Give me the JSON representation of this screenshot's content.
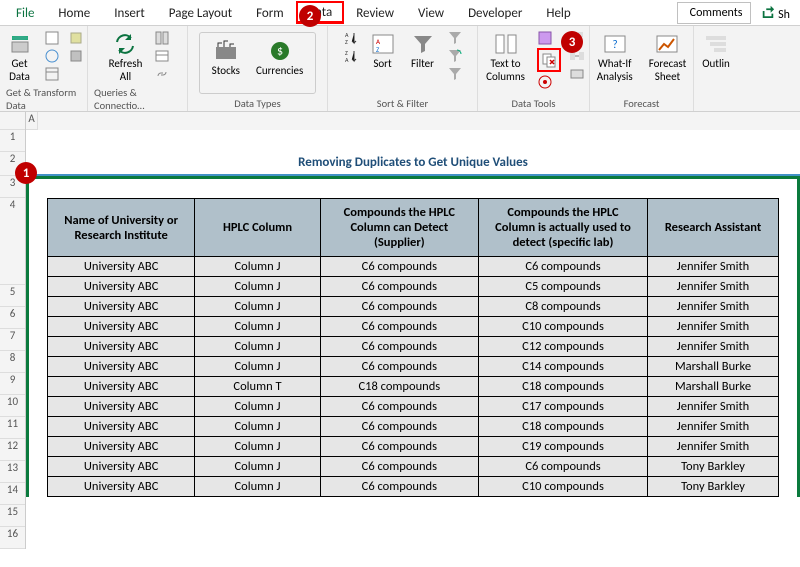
{
  "tabs": {
    "file": "File",
    "home": "Home",
    "insert": "Insert",
    "page_layout": "Page Layout",
    "formulas": "Form",
    "data": "Data",
    "review": "Review",
    "view": "View",
    "developer": "Developer",
    "help": "Help"
  },
  "title_actions": {
    "comments": "Comments",
    "share": "Sh"
  },
  "ribbon": {
    "get_data": "Get\nData",
    "refresh_all": "Refresh\nAll",
    "stocks": "Stocks",
    "currencies": "Currencies",
    "sort": "Sort",
    "filter": "Filter",
    "text_to_columns": "Text to\nColumns",
    "whatif": "What-If\nAnalysis",
    "forecast_sheet": "Forecast\nSheet",
    "outline": "Outlin",
    "groups": {
      "get_transform": "Get & Transform Data",
      "queries": "Queries & Connectio…",
      "data_types": "Data Types",
      "sort_filter": "Sort & Filter",
      "data_tools": "Data Tools",
      "forecast": "Forecast"
    }
  },
  "callouts": {
    "c1": "1",
    "c2": "2",
    "c3": "3"
  },
  "sheet_title": "Removing Duplicates to Get Unique Values",
  "row_numbers": [
    "",
    "1",
    "2",
    "3",
    "4",
    "5",
    "6",
    "7",
    "8",
    "9",
    "10",
    "11",
    "12",
    "13",
    "14",
    "15",
    "16"
  ],
  "col_A": "A",
  "headers": {
    "col1": "Name of University or Research Institute",
    "col2": "HPLC Column",
    "col3": "Compounds the HPLC Column can Detect (Supplier)",
    "col4": "Compounds the HPLC Column is actually used to detect (specific lab)",
    "col5": "Research Assistant"
  },
  "rows": [
    {
      "u": "University ABC",
      "c": "Column J",
      "s": "C6 compounds",
      "l": "C6 compounds",
      "r": "Jennifer Smith"
    },
    {
      "u": "University ABC",
      "c": "Column J",
      "s": "C6 compounds",
      "l": "C5 compounds",
      "r": "Jennifer Smith"
    },
    {
      "u": "University ABC",
      "c": "Column J",
      "s": "C6 compounds",
      "l": "C8 compounds",
      "r": "Jennifer Smith"
    },
    {
      "u": "University ABC",
      "c": "Column J",
      "s": "C6 compounds",
      "l": "C10 compounds",
      "r": "Jennifer Smith"
    },
    {
      "u": "University ABC",
      "c": "Column J",
      "s": "C6 compounds",
      "l": "C12 compounds",
      "r": "Jennifer Smith"
    },
    {
      "u": "University ABC",
      "c": "Column J",
      "s": "C6 compounds",
      "l": "C14 compounds",
      "r": "Marshall Burke"
    },
    {
      "u": "University ABC",
      "c": "Column T",
      "s": "C18 compounds",
      "l": "C18 compounds",
      "r": "Marshall Burke"
    },
    {
      "u": "University ABC",
      "c": "Column J",
      "s": "C6 compounds",
      "l": "C17 compounds",
      "r": "Jennifer Smith"
    },
    {
      "u": "University ABC",
      "c": "Column J",
      "s": "C6 compounds",
      "l": "C18 compounds",
      "r": "Jennifer Smith"
    },
    {
      "u": "University ABC",
      "c": "Column J",
      "s": "C6 compounds",
      "l": "C19 compounds",
      "r": "Jennifer Smith"
    },
    {
      "u": "University ABC",
      "c": "Column J",
      "s": "C6 compounds",
      "l": "C6 compounds",
      "r": "Tony Barkley"
    },
    {
      "u": "University ABC",
      "c": "Column J",
      "s": "C6 compounds",
      "l": "C10 compounds",
      "r": "Tony Barkley"
    }
  ]
}
